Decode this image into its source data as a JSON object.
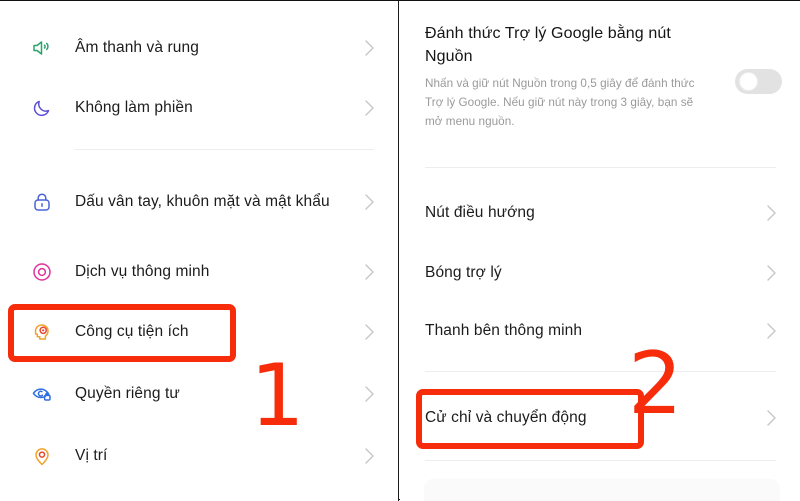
{
  "colors": {
    "annotation_red": "#f72c0b",
    "background": "#ffffff",
    "label_text": "#1c1c1c",
    "description_text": "#9a9a9a",
    "divider": "#ededed",
    "chevron": "#c9c9c9",
    "toggle_off_track": "#e2e2e2"
  },
  "left_panel": {
    "rows": [
      {
        "label": "Âm thanh và rung",
        "icon": "speaker-sound-icon",
        "chevron": "chevron-right-icon"
      },
      {
        "label": "Không làm phiền",
        "icon": "moon-icon",
        "chevron": "chevron-right-icon"
      },
      {
        "label": "Dấu vân tay, khuôn mặt và mật khẩu",
        "icon": "lock-fingerprint-icon",
        "chevron": "chevron-right-icon"
      },
      {
        "label": "Dịch vụ thông minh",
        "icon": "smart-service-icon",
        "chevron": "chevron-right-icon"
      },
      {
        "label": "Công cụ tiện ích",
        "icon": "head-utility-icon",
        "chevron": "chevron-right-icon"
      },
      {
        "label": "Quyền riêng tư",
        "icon": "privacy-eye-lock-icon",
        "chevron": "chevron-right-icon"
      },
      {
        "label": "Vị trí",
        "icon": "location-pin-icon",
        "chevron": "chevron-right-icon"
      }
    ],
    "step_number": "1"
  },
  "right_panel": {
    "assistant": {
      "title": "Đánh thức Trợ lý Google bằng nút Nguồn",
      "description": "Nhấn và giữ nút Nguồn trong 0,5 giây để đánh thức Trợ lý Google. Nếu giữ nút này trong 3 giây, bạn sẽ mở menu nguồn.",
      "toggle_state": "off"
    },
    "rows": [
      {
        "label": "Nút điều hướng",
        "chevron": "chevron-right-icon"
      },
      {
        "label": "Bóng trợ lý",
        "chevron": "chevron-right-icon"
      },
      {
        "label": "Thanh bên thông minh",
        "chevron": "chevron-right-icon"
      },
      {
        "label": "Cử chỉ và chuyển động",
        "chevron": "chevron-right-icon"
      }
    ],
    "step_number": "2"
  }
}
